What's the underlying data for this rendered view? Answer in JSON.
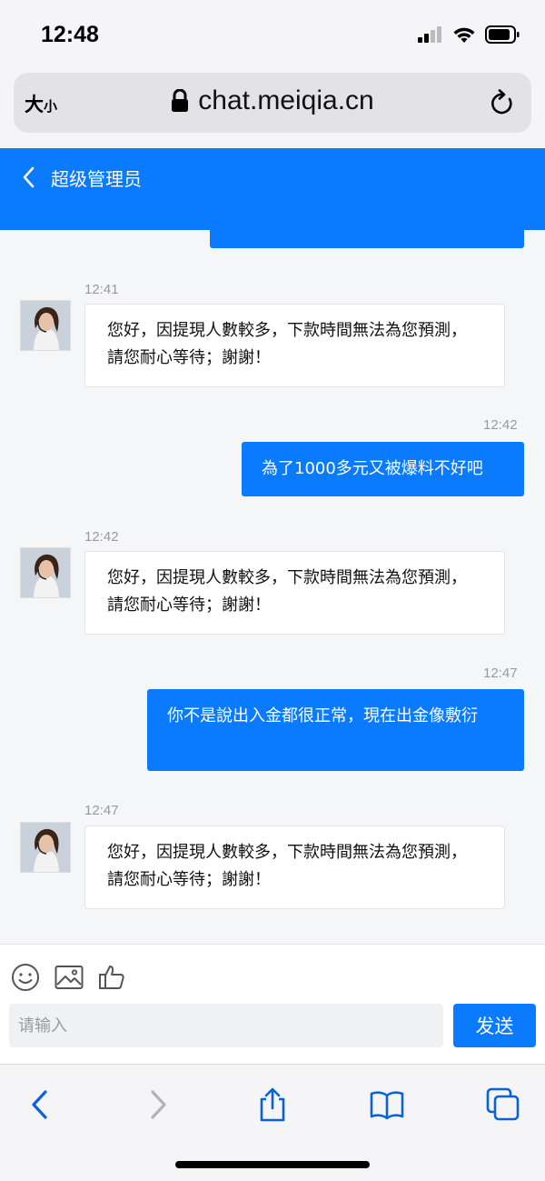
{
  "status_bar": {
    "time": "12:48"
  },
  "browser": {
    "text_size_label_big": "大",
    "text_size_label_small": "小",
    "url": "chat.meiqia.cn"
  },
  "chat_header": {
    "title": "超级管理员"
  },
  "messages": [
    {
      "direction": "incoming",
      "time": "12:41",
      "text": "您好，因提現人數較多，下款時間無法為您預測，請您耐心等待；謝謝！"
    },
    {
      "direction": "outgoing",
      "time": "12:42",
      "text": "為了1000多元又被爆料不好吧"
    },
    {
      "direction": "incoming",
      "time": "12:42",
      "text": "您好，因提現人數較多，下款時間無法為您預測，請您耐心等待；謝謝！"
    },
    {
      "direction": "outgoing",
      "time": "12:47",
      "text": "你不是說出入金都很正常，現在出金像敷衍"
    },
    {
      "direction": "incoming",
      "time": "12:47",
      "text": "您好，因提現人數較多，下款時間無法為您預測，請您耐心等待；謝謝！"
    }
  ],
  "compose": {
    "placeholder": "请输入",
    "send_label": "发送",
    "tools": [
      "emoji-icon",
      "image-icon",
      "thumbs-up-icon"
    ]
  },
  "colors": {
    "accent": "#0a7bff",
    "background": "#f5f6f8"
  }
}
